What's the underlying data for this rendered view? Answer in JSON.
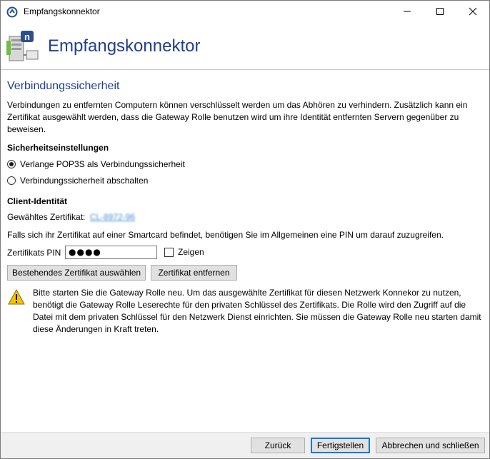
{
  "window": {
    "title": "Empfangskonnektor"
  },
  "header": {
    "title": "Empfangskonnektor",
    "icon": "server-network-icon"
  },
  "section": {
    "title": "Verbindungssicherheit",
    "description": "Verbindungen zu entfernten Computern können verschlüsselt werden um das Abhören zu verhindern. Zusätzlich kann ein Zertifikat ausgewählt werden, dass die Gateway Rolle benutzen wird um ihre Identität entfernten Servern gegenüber zu beweisen."
  },
  "security_settings": {
    "heading": "Sicherheitseinstellungen",
    "options": [
      {
        "label": "Verlange POP3S als Verbindungssicherheit",
        "checked": true
      },
      {
        "label": "Verbindungssicherheit abschalten",
        "checked": false
      }
    ]
  },
  "client_identity": {
    "heading": "Client-Identität",
    "selected_cert_label": "Gewähltes Zertifikat:",
    "selected_cert_value": "CL-8972-96",
    "smartcard_note": "Falls sich ihr Zertifikat auf einer Smartcard befindet, benötigen Sie im Allgemeinen eine PIN um darauf zuzugreifen.",
    "pin_label": "Zertifikats PIN",
    "pin_value": "●●●●",
    "show_label": "Zeigen",
    "show_checked": false,
    "select_button": "Bestehendes Zertifikat auswählen",
    "remove_button": "Zertifikat entfernen"
  },
  "warning": {
    "icon": "warning-icon",
    "text": "Bitte starten Sie die Gateway Rolle neu. Um das ausgewählte Zertifikat für diesen Netzwerk Konnekor zu nutzen, benötigt die Gateway Rolle Leserechte für den privaten Schlüssel des Zertifikats. Die Rolle wird den Zugriff auf die Datei mit dem privaten Schlüssel für den Netzwerk Dienst einrichten. Sie müssen die Gateway Rolle neu starten damit diese Änderungen in Kraft treten."
  },
  "footer": {
    "back_button": "Zurück",
    "finish_button": "Fertigstellen",
    "cancel_button": "Abbrechen und schließen"
  },
  "colors": {
    "accent_title": "#1f3f8f",
    "link": "#4a8ed8",
    "primary_border": "#0078d7",
    "warning_yellow": "#f2c500"
  }
}
